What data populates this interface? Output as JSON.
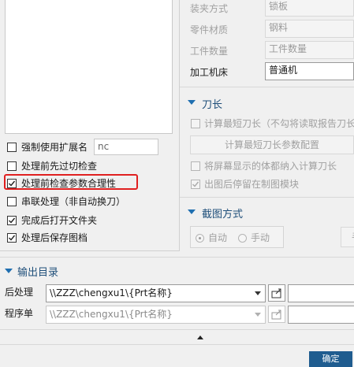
{
  "left_panel": {
    "checkboxes": [
      {
        "label": "强制使用扩展名",
        "checked": false,
        "ext_value": "nc"
      },
      {
        "label": "处理前先过切检查",
        "checked": false
      },
      {
        "label": "处理前检查参数合理性",
        "checked": true,
        "highlighted": true
      },
      {
        "label": "串联处理（非自动换刀）",
        "checked": false
      },
      {
        "label": "完成后打开文件夹",
        "checked": true
      },
      {
        "label": "处理后保存图档",
        "checked": true
      }
    ]
  },
  "right_panel": {
    "fields": [
      {
        "label": "装夹方式",
        "value": "锁板",
        "disabled": true
      },
      {
        "label": "零件材质",
        "value": "钢料",
        "disabled": true
      },
      {
        "label": "工件数量",
        "value": "工件数量",
        "disabled": true
      },
      {
        "label": "加工机床",
        "value": "普通机",
        "disabled": false
      }
    ],
    "tool_section": {
      "title": "刀长",
      "calc_checkbox": "计算最短刀长（不勾将读取报告刀长",
      "calc_button": "计算最短刀长参数配置",
      "screen_checkbox": "将屏幕显示的体都纳入计算刀长",
      "stop_checkbox": "出图后停留在制图模块"
    },
    "screenshot_section": {
      "title": "截图方式",
      "options": [
        "自动",
        "手动"
      ],
      "selected": "自动",
      "button_partial": "手"
    }
  },
  "output_section": {
    "title": "输出目录",
    "rows": [
      {
        "label": "后处理",
        "value": "\\\\ZZZ\\chengxu1\\{Prt名称}",
        "disabled": false
      },
      {
        "label": "程序单",
        "value": "\\\\ZZZ\\chengxu1\\{Prt名称}",
        "disabled": true
      }
    ]
  },
  "footer": {
    "confirm_button": "确定"
  },
  "colors": {
    "accent": "#1f6fb0",
    "highlight": "#e02020",
    "confirm_bg": "#1f5c8f"
  },
  "icons": [
    "checkmark-icon",
    "collapse-triangle-icon",
    "folder-export-icon",
    "dropdown-arrow-icon",
    "expand-up-icon"
  ]
}
